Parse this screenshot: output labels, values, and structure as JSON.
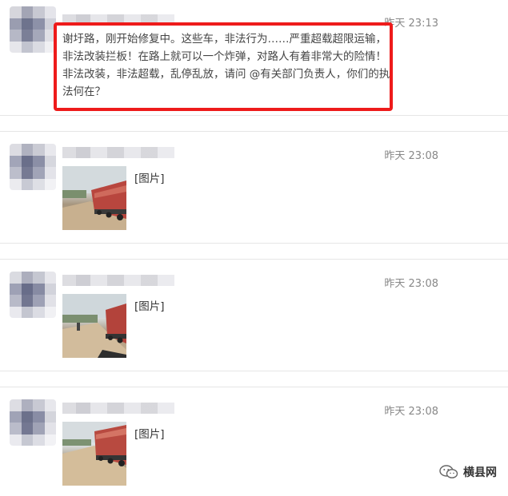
{
  "posts": [
    {
      "time": "昨天 23:13",
      "text": "谢圩路，刚开始修复中。这些车，非法行为……严重超载超限运输，非法改装拦板！在路上就可以一个炸弹，对路人有着非常大的险情！ 非法改装，非法超载，乱停乱放，请问 @有关部门负责人，你们的执法何在？"
    },
    {
      "time": "昨天 23:08",
      "image_label": "[图片]"
    },
    {
      "time": "昨天 23:08",
      "image_label": "[图片]"
    },
    {
      "time": "昨天 23:08",
      "image_label": "[图片]"
    }
  ],
  "watermark": {
    "text": "横县网",
    "icon": "wechat-icon"
  },
  "colors": {
    "highlight": "#ee1b1b",
    "time": "#888888",
    "separator": "#e6e6e6"
  }
}
